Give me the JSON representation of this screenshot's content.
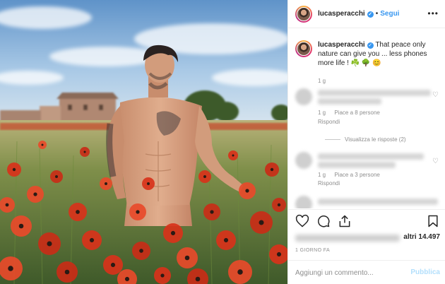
{
  "header": {
    "username": "lucasperacchi",
    "verified_icon": "verified-badge-icon",
    "separator": "•",
    "follow_label": "Segui",
    "more_icon": "ellipsis-icon",
    "more_glyph": "•••"
  },
  "caption": {
    "username": "lucasperacchi",
    "text": "That peace only nature can give you ... less phones more life ! ☘️ 🌳 😊",
    "age": "1 g"
  },
  "comments": [
    {
      "age": "1 g",
      "likes": "Piace a 8 persone",
      "reply_label": "Rispondi",
      "view_replies": "Visualizza le risposte (2)"
    },
    {
      "age": "1 g",
      "likes": "Piace a 3 persone",
      "reply_label": "Rispondi"
    }
  ],
  "actions": {
    "like_icon": "heart-icon",
    "comment_icon": "comment-icon",
    "share_icon": "share-icon",
    "save_icon": "bookmark-icon"
  },
  "likes": {
    "prefix": "altri",
    "count": "14.497"
  },
  "timestamp": "1 GIORNO FA",
  "add_comment": {
    "placeholder": "Aggiungi un commento...",
    "publish_label": "Pubblica"
  },
  "colors": {
    "accent": "#3897f0",
    "publish_disabled": "#b2dffc",
    "muted": "#8e8e8e",
    "poppy": "#e03a1c"
  }
}
